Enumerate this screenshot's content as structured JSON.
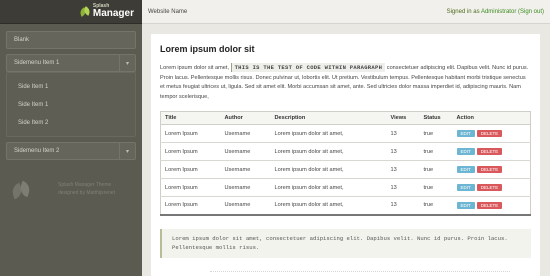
{
  "logo": {
    "small": "Splash",
    "big": "Manager"
  },
  "topbar": {
    "site_name": "Website Name",
    "signed_in_prefix": "Signed in as",
    "user": "Administrator",
    "sign_out": "(Sign out)"
  },
  "sidebar": {
    "items": [
      {
        "label": "Blank"
      },
      {
        "label": "Sidemenu Item 1",
        "chevron": "chevron-down-icon"
      },
      {
        "label": "Sidemenu Item 2",
        "chevron": "chevron-down-icon"
      }
    ],
    "submenu": [
      {
        "label": "Side Item 1"
      },
      {
        "label": "Side Item 1"
      },
      {
        "label": "Side Item 2"
      }
    ],
    "credit_line1": "Splash Manager Theme",
    "credit_line2": "designed by Matthijsrenet"
  },
  "main": {
    "title": "Lorem ipsum dolor sit",
    "para_before": "Lorem ipsum dolor sit amet,",
    "para_code": "THIS IS THE TEST OF CODE WITHIN PARAGRAPH",
    "para_after": " consectetuer adipiscing elit. Dapibus velit. Nunc id purus. Proin lacus. Pellentesque mollis risus. Donec pulvinar ut, lobortis elit. Ut pretium. Vestibulum tempus. Pellentesque habitant morbi tristique senectus et metus feugiat ultrices ut, ligula. Sed sit amet elit. Morbi accumsan sit amet, ante. Sed ultricies dolor massa imperdiet id, adipiscing mauris. Nam tempor scelerisque,",
    "table": {
      "headers": [
        "Title",
        "Author",
        "Description",
        "Views",
        "Status",
        "Action"
      ],
      "edit_label": "EDIT",
      "delete_label": "DELETE",
      "rows": [
        [
          "Lorem Ipsum",
          "Username",
          "Lorem ipsum dolor sit amet,",
          "13",
          "true"
        ],
        [
          "Lorem Ipsum",
          "Username",
          "Lorem ipsum dolor sit amet,",
          "13",
          "true"
        ],
        [
          "Lorem Ipsum",
          "Username",
          "Lorem ipsum dolor sit amet,",
          "13",
          "true"
        ],
        [
          "Lorem Ipsum",
          "Username",
          "Lorem ipsum dolor sit amet,",
          "13",
          "true"
        ],
        [
          "Lorem Ipsum",
          "Username",
          "Lorem ipsum dolor sit amet,",
          "13",
          "true"
        ]
      ]
    },
    "code_block": "Lorem ipsum dolor sit amet, consectetuer adipiscing elit. Dapibus velit. Nunc id purus. Proin lacus. Pellentesque mollis risus."
  },
  "colors": {
    "sidebar": "#5c5b52",
    "accent_green": "#3d8c1f",
    "edit_button": "#6cb6d3",
    "delete_button": "#d9585c"
  }
}
